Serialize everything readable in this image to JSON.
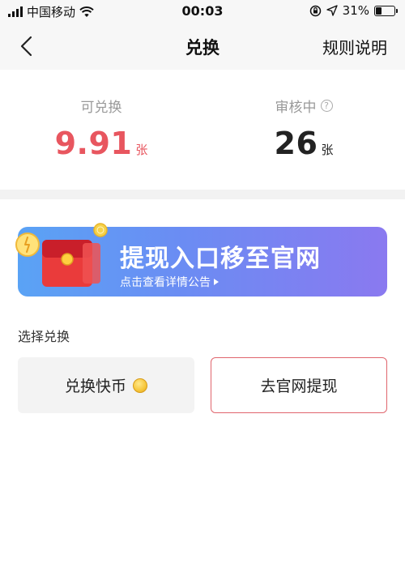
{
  "status_bar": {
    "carrier": "中国移动",
    "time": "00:03",
    "battery_percent": "31%",
    "battery_level": 0.31
  },
  "nav": {
    "back_icon": "chevron-left-icon",
    "title": "兑换",
    "rules_label": "规则说明"
  },
  "stats": {
    "redeemable": {
      "label": "可兑换",
      "value": "9.91",
      "unit": "张",
      "color": "#e8565f"
    },
    "reviewing": {
      "label": "审核中",
      "value": "26",
      "unit": "张",
      "help_icon": "?"
    }
  },
  "banner": {
    "title": "提现入口移至官网",
    "subtitle": "点击查看详情公告"
  },
  "exchange": {
    "section_label": "选择兑换",
    "option_coins": "兑换快币",
    "option_web": "去官网提现",
    "accent_color": "#e0656d"
  }
}
